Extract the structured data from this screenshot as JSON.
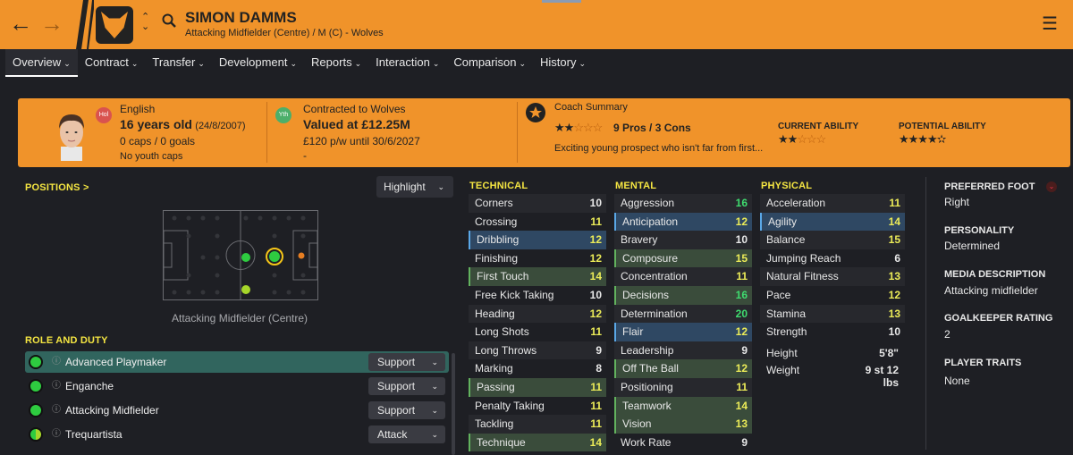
{
  "header": {
    "player_name": "SIMON DAMMS",
    "player_desc": "Attacking Midfielder (Centre) / M (C) - Wolves",
    "back_icon": "arrow-left-icon",
    "forward_icon": "arrow-right-icon",
    "menu_icon": "hamburger-icon"
  },
  "nav": {
    "tabs": [
      {
        "label": "Overview"
      },
      {
        "label": "Contract"
      },
      {
        "label": "Transfer"
      },
      {
        "label": "Development"
      },
      {
        "label": "Reports"
      },
      {
        "label": "Interaction"
      },
      {
        "label": "Comparison"
      },
      {
        "label": "History"
      }
    ]
  },
  "banner": {
    "nationality": "English",
    "nation_badge": "Hol",
    "age": "16 years old",
    "dob": "(24/8/2007)",
    "caps": "0 caps / 0 goals",
    "youth_caps": "No youth caps",
    "contract_badge": "Yth",
    "contracted_to": "Contracted to Wolves",
    "value": "Valued at £12.25M",
    "wage": "£120 p/w until 30/6/2027",
    "extra": "-",
    "coach_title": "Coach Summary",
    "coach_pros_cons": "9 Pros / 3 Cons",
    "coach_text": "Exciting young prospect who isn't far from first...",
    "current_ability_label": "CURRENT ABILITY",
    "potential_ability_label": "POTENTIAL ABILITY",
    "coach_stars": 2,
    "current_stars": 2,
    "potential_stars": 3.5
  },
  "positions": {
    "header": "POSITIONS >",
    "highlight_label": "Highlight",
    "caption": "Attacking Midfielder (Centre)"
  },
  "roles": {
    "header": "ROLE AND DUTY",
    "items": [
      {
        "name": "Advanced Playmaker",
        "duty": "Support",
        "color": "#2ecc40"
      },
      {
        "name": "Enganche",
        "duty": "Support",
        "color": "#2ecc40"
      },
      {
        "name": "Attacking Midfielder",
        "duty": "Support",
        "color": "#2ecc40"
      },
      {
        "name": "Trequartista",
        "duty": "Attack",
        "color": "#a6d62a"
      }
    ]
  },
  "technical": {
    "header": "TECHNICAL",
    "attrs": [
      {
        "name": "Corners",
        "value": "10"
      },
      {
        "name": "Crossing",
        "value": "11"
      },
      {
        "name": "Dribbling",
        "value": "12"
      },
      {
        "name": "Finishing",
        "value": "12"
      },
      {
        "name": "First Touch",
        "value": "14"
      },
      {
        "name": "Free Kick Taking",
        "value": "10"
      },
      {
        "name": "Heading",
        "value": "12"
      },
      {
        "name": "Long Shots",
        "value": "11"
      },
      {
        "name": "Long Throws",
        "value": "9"
      },
      {
        "name": "Marking",
        "value": "8"
      },
      {
        "name": "Passing",
        "value": "11"
      },
      {
        "name": "Penalty Taking",
        "value": "11"
      },
      {
        "name": "Tackling",
        "value": "11"
      },
      {
        "name": "Technique",
        "value": "14"
      }
    ]
  },
  "mental": {
    "header": "MENTAL",
    "attrs": [
      {
        "name": "Aggression",
        "value": "16"
      },
      {
        "name": "Anticipation",
        "value": "12"
      },
      {
        "name": "Bravery",
        "value": "10"
      },
      {
        "name": "Composure",
        "value": "15"
      },
      {
        "name": "Concentration",
        "value": "11"
      },
      {
        "name": "Decisions",
        "value": "16"
      },
      {
        "name": "Determination",
        "value": "20"
      },
      {
        "name": "Flair",
        "value": "12"
      },
      {
        "name": "Leadership",
        "value": "9"
      },
      {
        "name": "Off The Ball",
        "value": "12"
      },
      {
        "name": "Positioning",
        "value": "11"
      },
      {
        "name": "Teamwork",
        "value": "14"
      },
      {
        "name": "Vision",
        "value": "13"
      },
      {
        "name": "Work Rate",
        "value": "9"
      }
    ]
  },
  "physical": {
    "header": "PHYSICAL",
    "attrs": [
      {
        "name": "Acceleration",
        "value": "11"
      },
      {
        "name": "Agility",
        "value": "14"
      },
      {
        "name": "Balance",
        "value": "15"
      },
      {
        "name": "Jumping Reach",
        "value": "6"
      },
      {
        "name": "Natural Fitness",
        "value": "13"
      },
      {
        "name": "Pace",
        "value": "12"
      },
      {
        "name": "Stamina",
        "value": "13"
      },
      {
        "name": "Strength",
        "value": "10"
      }
    ],
    "height_label": "Height",
    "height": "5'8\"",
    "weight_label": "Weight",
    "weight": "9 st 12 lbs"
  },
  "info": {
    "preferred_foot_label": "PREFERRED FOOT",
    "preferred_foot": "Right",
    "personality_label": "PERSONALITY",
    "personality": "Determined",
    "media_label": "MEDIA DESCRIPTION",
    "media": "Attacking midfielder",
    "gk_label": "GOALKEEPER RATING",
    "gk": "2",
    "traits_label": "PLAYER TRAITS",
    "traits": "None"
  }
}
